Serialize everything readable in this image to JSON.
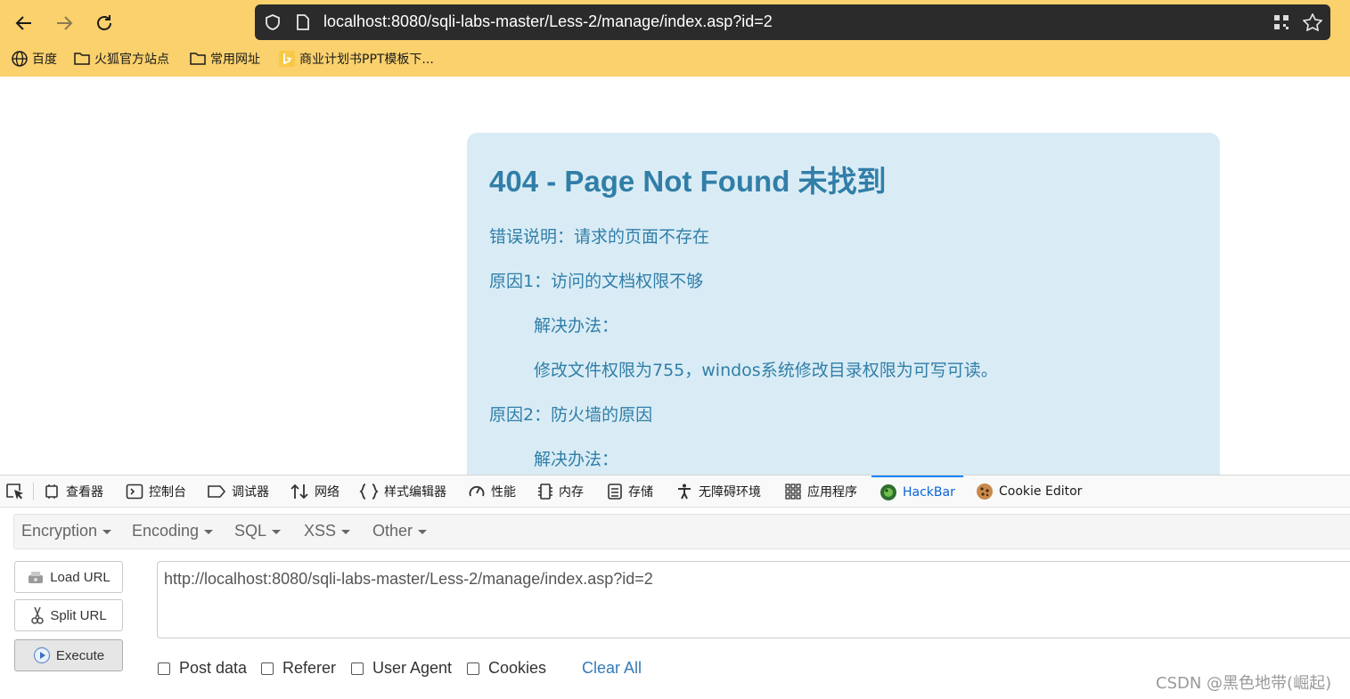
{
  "browser": {
    "url": "localhost:8080/sqli-labs-master/Less-2/manage/index.asp?id=2",
    "bookmarks": [
      {
        "label": "百度",
        "icon": "globe-icon"
      },
      {
        "label": "火狐官方站点",
        "icon": "folder-icon"
      },
      {
        "label": "常用网址",
        "icon": "folder-icon"
      },
      {
        "label": "商业计划书PPT模板下...",
        "icon": "bing-icon"
      }
    ]
  },
  "error_page": {
    "title": "404 - Page Not Found 未找到",
    "lines": [
      "错误说明：请求的页面不存在",
      "原因1：访问的文档权限不够",
      "解决办法：",
      "修改文件权限为755，windos系统修改目录权限为可写可读。",
      "原因2：防火墙的原因",
      "解决办法："
    ]
  },
  "devtools": {
    "tabs": [
      {
        "label": "查看器",
        "icon": "inspector-icon"
      },
      {
        "label": "控制台",
        "icon": "console-icon"
      },
      {
        "label": "调试器",
        "icon": "debugger-icon"
      },
      {
        "label": "网络",
        "icon": "network-icon"
      },
      {
        "label": "样式编辑器",
        "icon": "style-editor-icon"
      },
      {
        "label": "性能",
        "icon": "performance-icon"
      },
      {
        "label": "内存",
        "icon": "memory-icon"
      },
      {
        "label": "存储",
        "icon": "storage-icon"
      },
      {
        "label": "无障碍环境",
        "icon": "accessibility-icon"
      },
      {
        "label": "应用程序",
        "icon": "application-icon"
      },
      {
        "label": "HackBar",
        "icon": "hackbar-icon",
        "active": true
      },
      {
        "label": "Cookie Editor",
        "icon": "cookie-icon"
      }
    ]
  },
  "hackbar": {
    "menu": [
      "Encryption",
      "Encoding",
      "SQL",
      "XSS",
      "Other"
    ],
    "load_url": "Load URL",
    "split_url": "Split URL",
    "execute": "Execute",
    "url_value": "http://localhost:8080/sqli-labs-master/Less-2/manage/index.asp?id=2",
    "options": [
      "Post data",
      "Referer",
      "User Agent",
      "Cookies"
    ],
    "clear_all": "Clear All"
  },
  "watermark": "CSDN @黑色地带(崛起)",
  "colors": {
    "chrome_bg": "#fbd16d",
    "urlbar_bg": "#2b2b2b",
    "error_box_bg": "#d9ecf5",
    "error_text": "#317ea8",
    "active_tab": "#0a84ff",
    "link": "#337ab7"
  }
}
